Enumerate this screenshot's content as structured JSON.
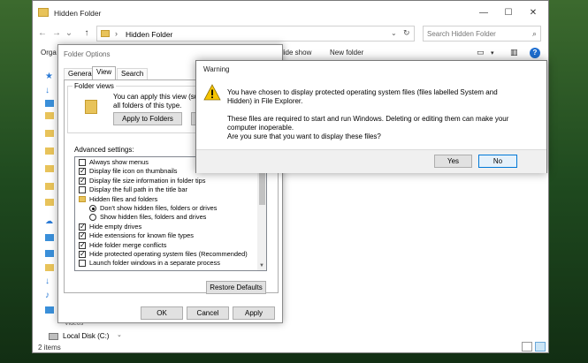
{
  "explorer": {
    "title": "Hidden Folder",
    "address_path": "Hidden Folder",
    "search_placeholder": "Search Hidden Folder",
    "commands": {
      "organize": "Orga",
      "slideshow": "lide show",
      "new_folder": "New folder"
    },
    "nav": {
      "videos": "Videos",
      "local_disk": "Local Disk (C:)"
    },
    "status_items": "2 items"
  },
  "folder_options": {
    "title": "Folder Options",
    "tabs": [
      "General",
      "View",
      "Search"
    ],
    "active_tab": "View",
    "folder_views": {
      "heading": "Folder views",
      "line1": "You can apply this view (such",
      "line2": "all folders of this type.",
      "apply_label": "Apply to Folders"
    },
    "advanced_label": "Advanced settings:",
    "advanced_items": [
      {
        "kind": "checkbox",
        "checked": false,
        "text": "Always show menus"
      },
      {
        "kind": "checkbox",
        "checked": true,
        "text": "Display file icon on thumbnails"
      },
      {
        "kind": "checkbox",
        "checked": true,
        "text": "Display file size information in folder tips"
      },
      {
        "kind": "checkbox",
        "checked": false,
        "text": "Display the full path in the title bar"
      },
      {
        "kind": "folder",
        "text": "Hidden files and folders"
      },
      {
        "kind": "radio",
        "checked": true,
        "text": "Don't show hidden files, folders or drives"
      },
      {
        "kind": "radio",
        "checked": false,
        "text": "Show hidden files, folders and drives"
      },
      {
        "kind": "checkbox",
        "checked": true,
        "text": "Hide empty drives"
      },
      {
        "kind": "checkbox",
        "checked": true,
        "text": "Hide extensions for known file types"
      },
      {
        "kind": "checkbox",
        "checked": true,
        "text": "Hide folder merge conflicts"
      },
      {
        "kind": "checkbox",
        "checked": true,
        "text": "Hide protected operating system files (Recommended)"
      },
      {
        "kind": "checkbox",
        "checked": false,
        "text": "Launch folder windows in a separate process"
      }
    ],
    "restore_label": "Restore Defaults",
    "ok_label": "OK",
    "cancel_label": "Cancel",
    "apply_label": "Apply"
  },
  "warning": {
    "title": "Warning",
    "line1": "You have chosen to display protected operating system files (files labelled System and",
    "line2": "Hidden) in File Explorer.",
    "line3": "These files are required to start and run Windows. Deleting or editing them can make your",
    "line4": "computer inoperable.",
    "line5": "Are you sure that you want to display these files?",
    "yes_label": "Yes",
    "no_label": "No"
  },
  "icons": {
    "folder": "folder-icon",
    "back": "back-arrow-icon",
    "forward": "forward-arrow-icon",
    "up": "up-arrow-icon",
    "refresh": "refresh-icon",
    "search": "search-icon",
    "warning": "warning-triangle-icon",
    "help": "help-icon"
  },
  "colors": {
    "accent": "#0078d7",
    "warning_yellow": "#f5c400",
    "folder_yellow": "#e8c35a"
  }
}
